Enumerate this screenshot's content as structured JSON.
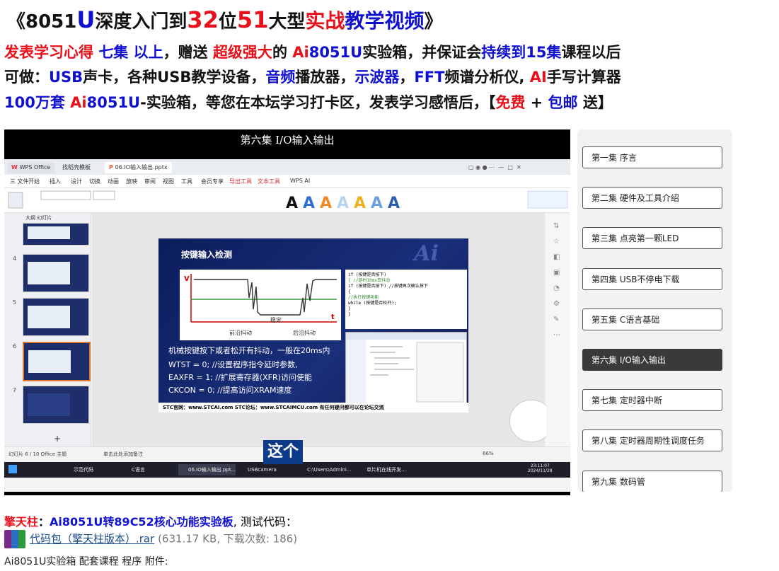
{
  "header": {
    "t1": "《8051",
    "t2": "U",
    "t3": "深度入门到",
    "t4": "32",
    "t5": "位",
    "t6": "51",
    "t7": "大型",
    "t8": "实战",
    "t9": "教学视频",
    "t10": "》"
  },
  "line1": {
    "a": "发表学习心得 ",
    "b": "七集 以上",
    "c": "，赠送 ",
    "d": "超级强大",
    "e": "的 ",
    "f": "Ai",
    "g": "8051U",
    "h": "实验箱，并保证会",
    "i": "持续到15集",
    "j": "课程以后"
  },
  "line2": {
    "a": "可做：",
    "b": "USB",
    "c": "声卡，各种USB教学设备，",
    "d": "音频",
    "e": "播放器，",
    "f": "示波器",
    "g": "，",
    "h": "FFT",
    "i": "频谱分析仪, ",
    "j": "AI",
    "k": "手写计算器"
  },
  "line3": {
    "a": "100万套 ",
    "b": "Ai",
    "c": "8051U",
    "d": "-实验箱，等您在本坛学习打卡区，发表学习感悟后，【",
    "e": "免费",
    "f": " + ",
    "g": "包邮",
    "h": " 送】"
  },
  "video": {
    "title": "第六集 I/O输入输出",
    "caption": "这个",
    "tabs": [
      "WPS Office",
      "找稻壳模板",
      "06.IO输入输出.pptx"
    ],
    "menu": [
      "三 文件",
      "开始",
      "插入",
      "设计",
      "切换",
      "动画",
      "放映",
      "审阅",
      "视图",
      "工具",
      "会员专享",
      "导出工具",
      "文本工具",
      "WPS AI"
    ],
    "slide_title": "按键输入检测",
    "slide_watermark": "Ai",
    "wave_labels": {
      "v": "V",
      "t": "t",
      "stable": "稳定",
      "front": "前沿抖动",
      "back": "后沿抖动"
    },
    "code_lines": [
      "if (按键是否按下)",
      "{    //延时10ms去抖动",
      "    if (按键是否按下)    //按键再次确认按下",
      "    {",
      "        //执行按键功能",
      "        while (按键是否松开);",
      "    }",
      "}"
    ],
    "bullets": [
      "机械按键按下或者松开有抖动，一般在20ms内",
      "WTST = 0;  //设置程序指令延时参数,",
      "EAXFR = 1; //扩展寄存器(XFR)访问使能",
      "CKCON = 0; //提高访问XRAM速度"
    ],
    "slide_footer": "STC官网：www.STCAI.com      STC论坛：www.STCAIMCU.com     有任何疑问都可以在论坛交流",
    "thumb_numbers": [
      "4",
      "5",
      "6",
      "7"
    ],
    "status_left": "幻灯片 6 / 10   Office 主题",
    "status_note": "单击此处添加备注",
    "zoom": "66%",
    "clock_time": "23:11:07",
    "clock_date": "2024/11/28",
    "taskbar_items": [
      "示范代码",
      "C语言",
      "06.IO输入输出.ppt...",
      "USBcamera",
      "C:\\Users\\Admini...",
      "单片机在线开发..."
    ],
    "sidebar_label": "大纲  幻灯片"
  },
  "playlist": {
    "items": [
      "第一集 序言",
      "第二集 硬件及工具介绍",
      "第三集 点亮第一颗LED",
      "第四集 USB不停电下载",
      "第五集 C语言基础",
      "第六集 I/O输入输出",
      "第七集 定时器中断",
      "第八集 定时器周期性调度任务",
      "第九集 数码管"
    ],
    "active_index": 5
  },
  "footer": {
    "author": "擎天柱",
    "sep": "：",
    "board": "Ai8051U转89C52核心功能实验板",
    "tail": ", 测试代码：",
    "attach_name": "代码包（擎天柱版本）.rar",
    "attach_meta": " (631.17 KB, 下载次数: 186)",
    "line3": "Ai8051U实验箱 配套课程 程序 附件:"
  },
  "colors": {
    "blue": "#1010d0",
    "red": "#e8101a",
    "active_ep": "#3a3a3a"
  }
}
